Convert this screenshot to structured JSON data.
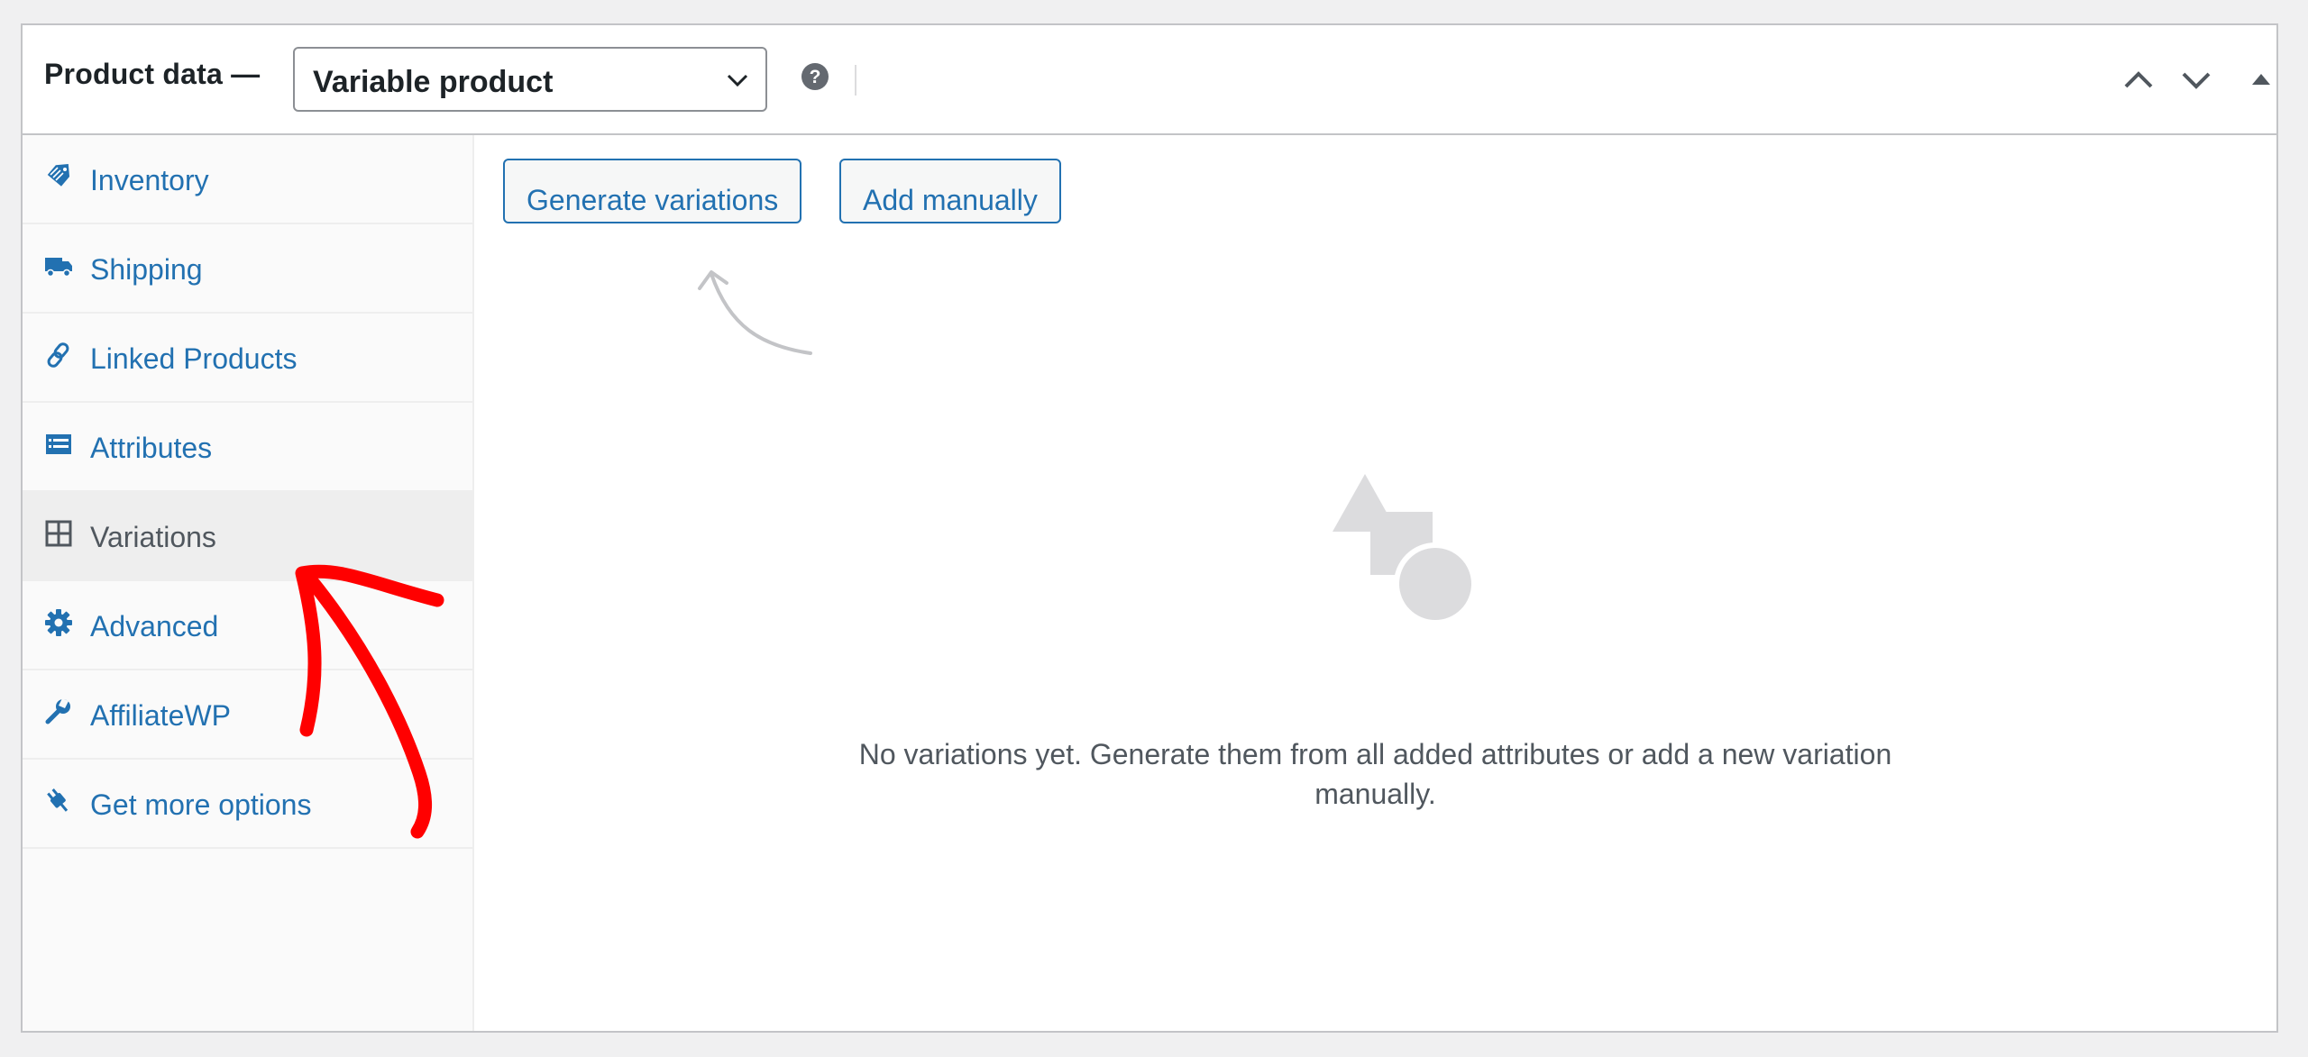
{
  "header": {
    "title": "Product data —",
    "product_type": "Variable product",
    "help_icon": "question-circle-icon",
    "controls": [
      "chevron-up-icon",
      "chevron-down-icon",
      "triangle-up-icon"
    ]
  },
  "sidebar": {
    "items": [
      {
        "label": "Inventory",
        "icon": "tag-icon",
        "active": false
      },
      {
        "label": "Shipping",
        "icon": "truck-icon",
        "active": false
      },
      {
        "label": "Linked Products",
        "icon": "link-icon",
        "active": false
      },
      {
        "label": "Attributes",
        "icon": "list-card-icon",
        "active": false
      },
      {
        "label": "Variations",
        "icon": "grid-icon",
        "active": true
      },
      {
        "label": "Advanced",
        "icon": "gear-icon",
        "active": false
      },
      {
        "label": "AffiliateWP",
        "icon": "wrench-icon",
        "active": false
      },
      {
        "label": "Get more options",
        "icon": "plugin-icon",
        "active": false
      }
    ]
  },
  "main": {
    "generate_label": "Generate variations",
    "add_manually_label": "Add manually",
    "empty_line1": "No variations yet. Generate them from all added attributes or add a new variation",
    "empty_line2": "manually.",
    "empty_icon": "shapes-icon"
  },
  "colors": {
    "link": "#2271b1",
    "active_tab_bg": "#eeeeee",
    "annotation_arrow": "#ff0000"
  }
}
